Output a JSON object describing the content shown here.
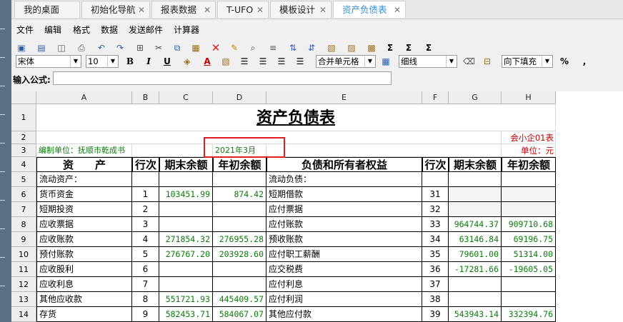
{
  "tabs": [
    {
      "label": "我的桌面",
      "closable": false
    },
    {
      "label": "初始化导航",
      "closable": true
    },
    {
      "label": "报表数据",
      "closable": true
    },
    {
      "label": "T-UFO",
      "closable": true
    },
    {
      "label": "模板设计",
      "closable": true
    },
    {
      "label": "资产负债表",
      "closable": true,
      "active": true
    }
  ],
  "menu": [
    "文件",
    "编辑",
    "格式",
    "数据",
    "发送邮件",
    "计算器"
  ],
  "toolbar": {
    "font": "宋体",
    "size": "10",
    "bold": "B",
    "italic": "I",
    "underline": "U",
    "fontcolor": "A",
    "merge": "合并单元格",
    "border": "细线",
    "fill": "向下填充",
    "percent": "%",
    "comma": ","
  },
  "formula": {
    "label": "输入公式:",
    "value": ""
  },
  "columns": [
    "A",
    "B",
    "C",
    "D",
    "E",
    "F",
    "G",
    "H"
  ],
  "rows": [
    "1",
    "2",
    "3",
    "4",
    "5",
    "6",
    "7",
    "8",
    "9",
    "10",
    "11",
    "12",
    "13",
    "14"
  ],
  "sheet": {
    "title": "资产负债表",
    "form_code": "会小企01表",
    "org": "编制单位：抚顺市乾成书",
    "date": "2021年3月",
    "unit": "单位：元",
    "headers": {
      "asset": "资　　产",
      "line1": "行次",
      "end1": "期末余额",
      "begin1": "年初余额",
      "liab": "负债和所有者权益",
      "line2": "行次",
      "end2": "期末余额",
      "begin2": "年初余额"
    },
    "body": [
      {
        "a": "流动资产：",
        "b": "",
        "c": "",
        "d": "",
        "e": "流动负债：",
        "f": "",
        "g": "",
        "h": ""
      },
      {
        "a": "货币资金",
        "b": "1",
        "c": "103451.99",
        "d": "874.42",
        "e": "短期借款",
        "f": "31",
        "g": "",
        "h": ""
      },
      {
        "a": "短期投资",
        "b": "2",
        "c": "",
        "d": "",
        "e": "应付票据",
        "f": "32",
        "g": "",
        "h": ""
      },
      {
        "a": "应收票据",
        "b": "3",
        "c": "",
        "d": "",
        "e": "应付账款",
        "f": "33",
        "g": "964744.37",
        "h": "909710.68"
      },
      {
        "a": "应收账款",
        "b": "4",
        "c": "271854.32",
        "d": "276955.28",
        "e": "预收账款",
        "f": "34",
        "g": "63146.84",
        "h": "69196.75"
      },
      {
        "a": "预付账款",
        "b": "5",
        "c": "276767.20",
        "d": "203928.60",
        "e": "应付职工薪酬",
        "f": "35",
        "g": "79601.00",
        "h": "51314.00"
      },
      {
        "a": "应收股利",
        "b": "6",
        "c": "",
        "d": "",
        "e": "应交税费",
        "f": "36",
        "g": "-17281.66",
        "h": "-19605.05"
      },
      {
        "a": "应收利息",
        "b": "7",
        "c": "",
        "d": "",
        "e": "应付利息",
        "f": "37",
        "g": "",
        "h": ""
      },
      {
        "a": "其他应收款",
        "b": "8",
        "c": "551721.93",
        "d": "445409.57",
        "e": "应付利润",
        "f": "38",
        "g": "",
        "h": ""
      },
      {
        "a": "存货",
        "b": "9",
        "c": "582453.71",
        "d": "584067.07",
        "e": "其他应付款",
        "f": "39",
        "g": "543943.14",
        "h": "332394.76"
      }
    ]
  },
  "colors": {
    "accent": "#2f8fd8",
    "green": "#0a7d0a",
    "red": "#c00000",
    "highlight": "#e02020"
  },
  "icons": [
    "save-icon",
    "save-as-icon",
    "print-preview-icon",
    "print-icon",
    "undo-icon",
    "redo-icon",
    "select-all-icon",
    "cut-icon",
    "copy-icon",
    "paste-icon",
    "delete-icon",
    "format-brush-icon",
    "find-icon",
    "insert-row-icon",
    "sort-asc-icon",
    "sort-desc-icon",
    "filter-icon",
    "image-icon",
    "sum-icon",
    "sum-all-icon"
  ]
}
